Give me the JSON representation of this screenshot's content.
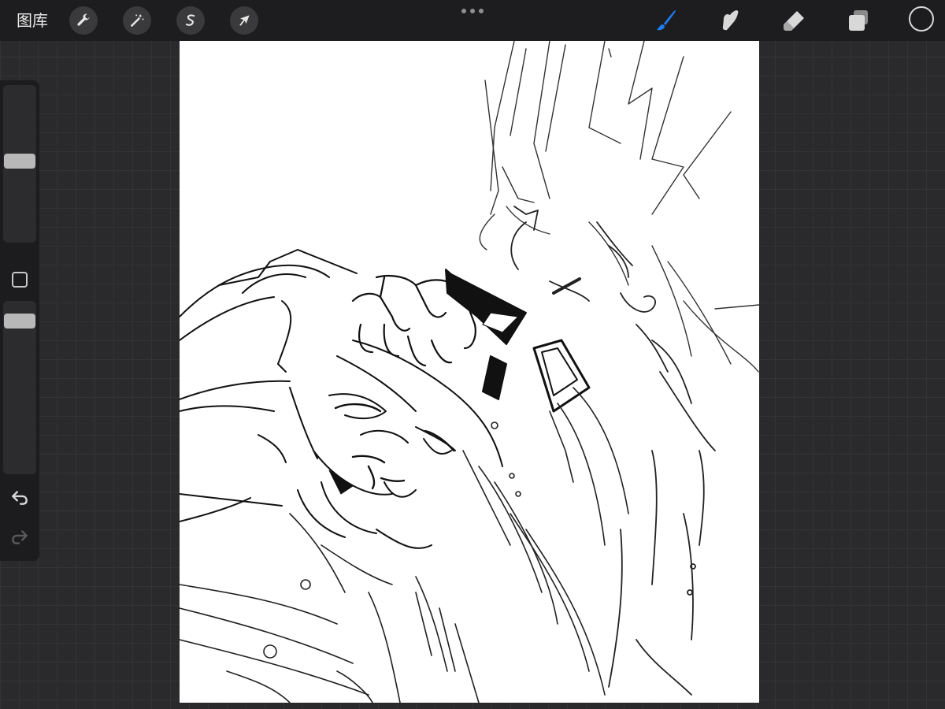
{
  "topbar": {
    "gallery_label": "图库",
    "left_tools": [
      {
        "name": "actions",
        "icon": "wrench-icon"
      },
      {
        "name": "adjustments",
        "icon": "magic-wand-icon"
      },
      {
        "name": "selection",
        "icon": "selection-s-icon"
      },
      {
        "name": "transform",
        "icon": "arrow-cursor-icon"
      }
    ],
    "more_menu_icon": "more-dots-icon",
    "right_tools": [
      {
        "name": "paint",
        "icon": "brush-icon",
        "active": true
      },
      {
        "name": "smudge",
        "icon": "smudge-finger-icon",
        "active": false
      },
      {
        "name": "erase",
        "icon": "eraser-icon",
        "active": false
      },
      {
        "name": "layers",
        "icon": "layers-icon",
        "active": false
      }
    ]
  },
  "colors": {
    "toolbar_bg": "#1d1d1f",
    "workspace_bg": "#2a2a2c",
    "active_tool": "#1e7cf2",
    "icon": "#d8d8d8",
    "canvas": "#ffffff",
    "current_color": "#1d1d1f"
  },
  "sidebar": {
    "brush_size_level": 0.52,
    "opacity_level": 0.92,
    "modify_icon": "square-modify-icon",
    "undo_icon": "undo-arrow-icon",
    "redo_icon": "redo-arrow-icon",
    "redo_enabled": false
  },
  "canvas": {
    "content": "ink-sketch-artwork"
  }
}
